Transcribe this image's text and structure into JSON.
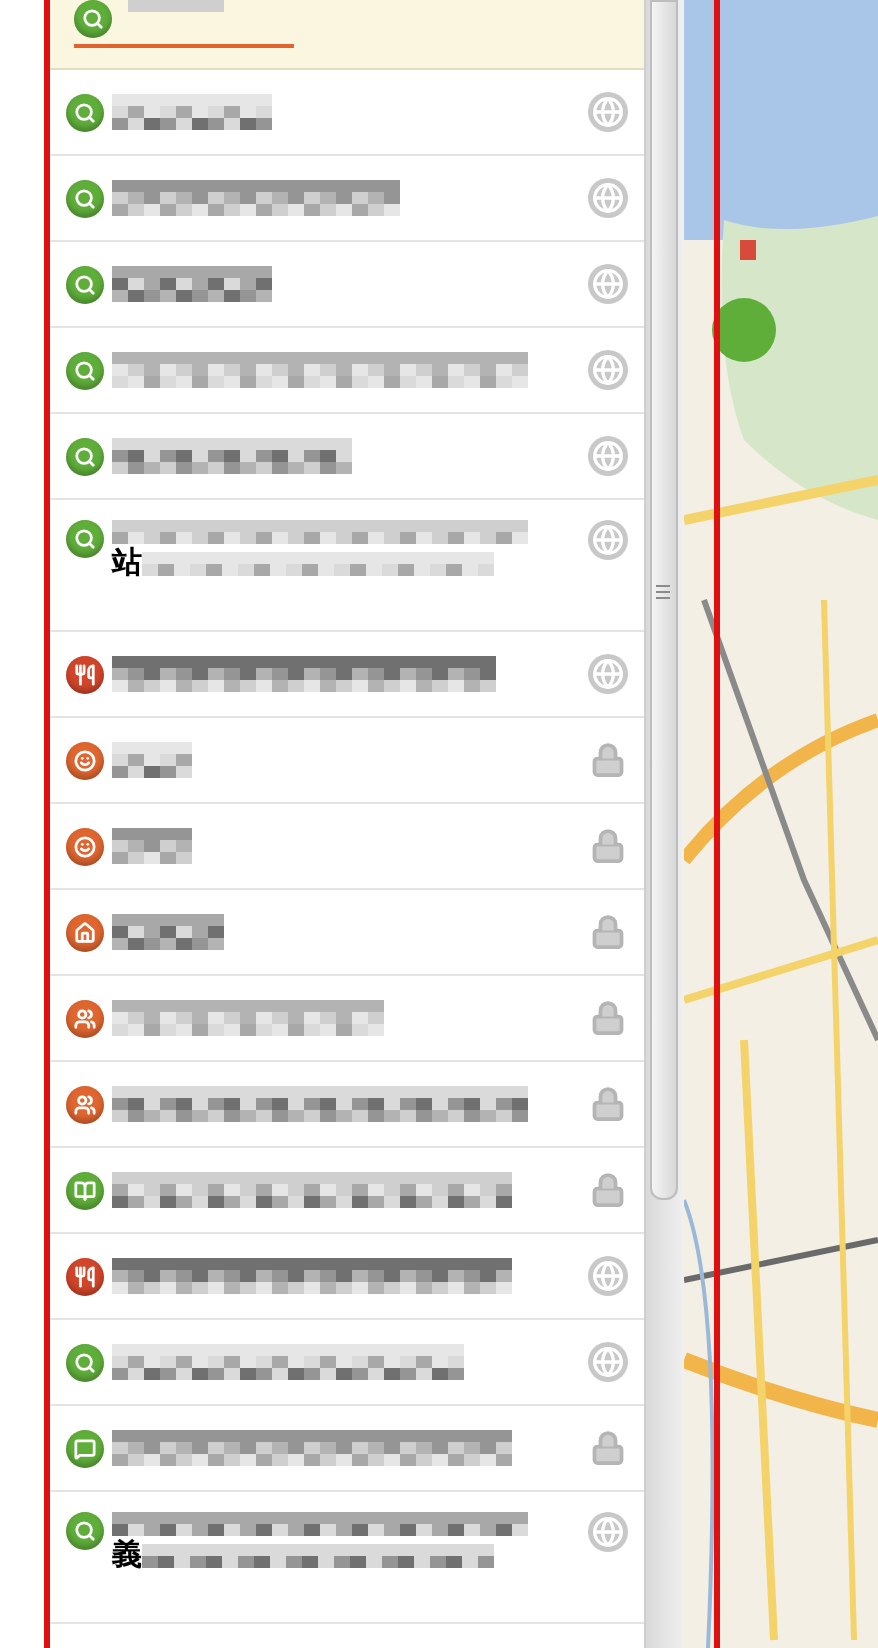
{
  "rows": [
    {
      "kind": "search",
      "locked": false
    },
    {
      "kind": "search",
      "locked": false
    },
    {
      "kind": "search",
      "locked": false
    },
    {
      "kind": "search",
      "locked": false
    },
    {
      "kind": "search",
      "locked": false
    },
    {
      "kind": "search",
      "locked": false,
      "extra_text": "站"
    },
    {
      "kind": "food",
      "locked": false
    },
    {
      "kind": "smile",
      "locked": true
    },
    {
      "kind": "smile",
      "locked": true
    },
    {
      "kind": "home",
      "locked": true
    },
    {
      "kind": "people",
      "locked": true
    },
    {
      "kind": "people",
      "locked": true
    },
    {
      "kind": "book",
      "locked": true
    },
    {
      "kind": "food",
      "locked": false
    },
    {
      "kind": "search",
      "locked": false
    },
    {
      "kind": "chat",
      "locked": true
    },
    {
      "kind": "search",
      "locked": false,
      "extra_text": "義"
    }
  ]
}
